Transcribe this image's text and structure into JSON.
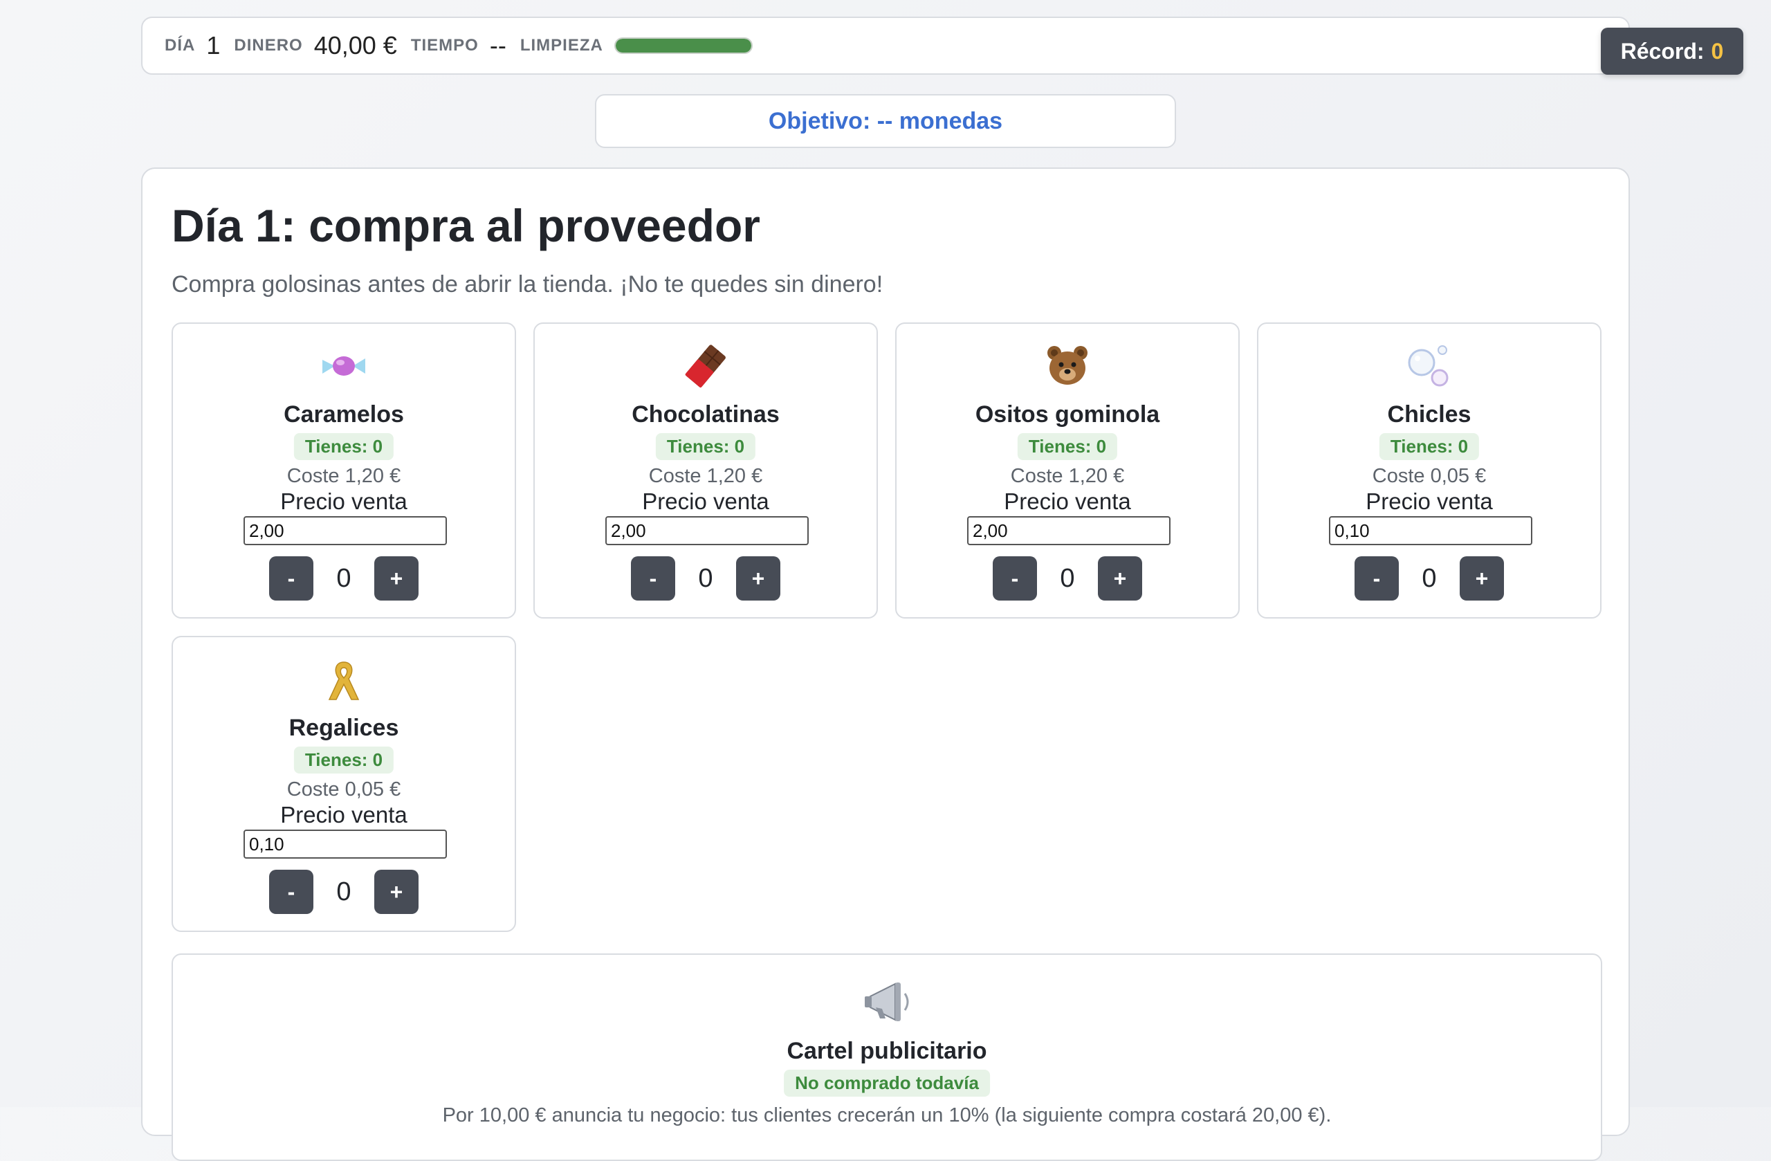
{
  "status": {
    "day_label": "DÍA",
    "day_value": "1",
    "money_label": "DINERO",
    "money_value": "40,00 €",
    "time_label": "TIEMPO",
    "time_value": "--",
    "clean_label": "LIMPIEZA",
    "clean_level": 1.0,
    "clean_color": "#4a8f4a"
  },
  "record": {
    "label": "Récord:",
    "value": "0"
  },
  "objective": "Objetivo: -- monedas",
  "shop": {
    "title": "Día 1: compra al proveedor",
    "subtitle": "Compra golosinas antes de abrir la tienda. ¡No te quedes sin dinero!",
    "products": [
      {
        "icon": "candy-icon",
        "name": "Caramelos",
        "have": "Tienes: 0",
        "cost": "Coste 1,20 €",
        "sell_label": "Precio venta",
        "price": "2,00",
        "qty": "0",
        "minus": "-",
        "plus": "+"
      },
      {
        "icon": "chocolate-bar-icon",
        "name": "Chocolatinas",
        "have": "Tienes: 0",
        "cost": "Coste 1,20 €",
        "sell_label": "Precio venta",
        "price": "2,00",
        "qty": "0",
        "minus": "-",
        "plus": "+"
      },
      {
        "icon": "bear-icon",
        "name": "Ositos gominola",
        "have": "Tienes: 0",
        "cost": "Coste 1,20 €",
        "sell_label": "Precio venta",
        "price": "2,00",
        "qty": "0",
        "minus": "-",
        "plus": "+"
      },
      {
        "icon": "bubbles-icon",
        "name": "Chicles",
        "have": "Tienes: 0",
        "cost": "Coste 0,05 €",
        "sell_label": "Precio venta",
        "price": "0,10",
        "qty": "0",
        "minus": "-",
        "plus": "+"
      },
      {
        "icon": "ribbon-icon",
        "name": "Regalices",
        "have": "Tienes: 0",
        "cost": "Coste 0,05 €",
        "sell_label": "Precio venta",
        "price": "0,10",
        "qty": "0",
        "minus": "-",
        "plus": "+"
      }
    ],
    "ad": {
      "icon": "megaphone-icon",
      "name": "Cartel publicitario",
      "status": "No comprado todavía",
      "description": "Por 10,00 € anuncia tu negocio: tus clientes crecerán un 10% (la siguiente compra costará 20,00 €)."
    }
  }
}
